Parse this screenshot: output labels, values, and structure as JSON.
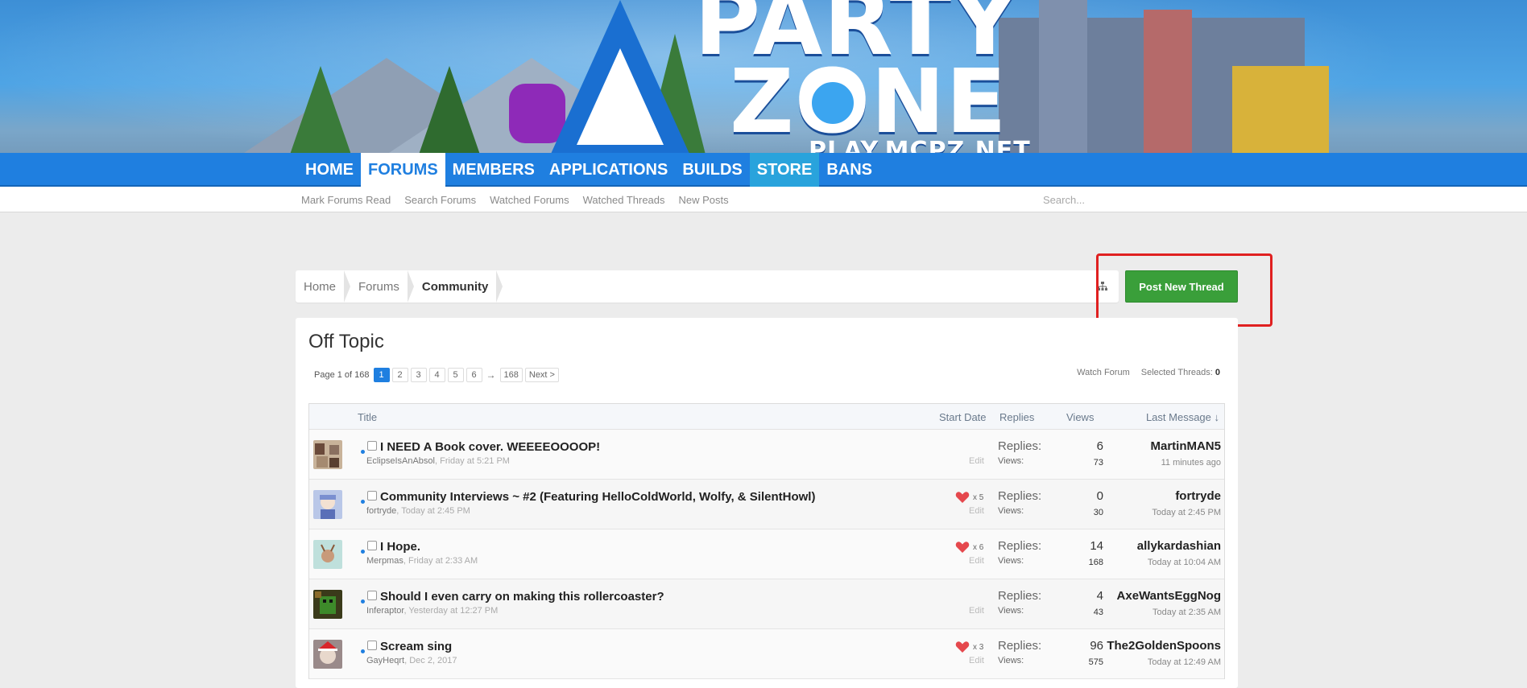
{
  "banner": {
    "logo_line1": "PARTY",
    "logo_line2": "ZONE",
    "logo_url": "PLAY.MCPZ.NET"
  },
  "nav": {
    "tabs": [
      {
        "label": "HOME"
      },
      {
        "label": "FORUMS"
      },
      {
        "label": "MEMBERS"
      },
      {
        "label": "APPLICATIONS"
      },
      {
        "label": "BUILDS"
      },
      {
        "label": "STORE"
      },
      {
        "label": "BANS"
      }
    ]
  },
  "subnav": {
    "links": [
      "Mark Forums Read",
      "Search Forums",
      "Watched Forums",
      "Watched Threads",
      "New Posts"
    ],
    "search_placeholder": "Search..."
  },
  "breadcrumb": {
    "items": [
      "Home",
      "Forums",
      "Community"
    ]
  },
  "actions": {
    "post_new_thread": "Post New Thread"
  },
  "forum": {
    "title": "Off Topic",
    "page_label": "Page 1 of 168",
    "pages": [
      "1",
      "2",
      "3",
      "4",
      "5",
      "6"
    ],
    "ellipsis": "→",
    "last_page": "168",
    "next": "Next >",
    "watch": "Watch Forum",
    "selected_label": "Selected Threads:",
    "selected_count": "0"
  },
  "table": {
    "headers": {
      "title": "Title",
      "start_date": "Start Date",
      "replies": "Replies",
      "views": "Views",
      "last_message": "Last Message ↓"
    },
    "labels": {
      "replies": "Replies:",
      "views": "Views:",
      "edit": "Edit"
    },
    "rows": [
      {
        "title": "I NEED A Book cover. WEEEEOOOOP!",
        "author": "EclipseIsAnAbsol",
        "date": "Friday at 5:21 PM",
        "likes": "",
        "replies": "6",
        "views": "73",
        "last_user": "MartinMAN5",
        "last_time": "11 minutes ago"
      },
      {
        "title": "Community Interviews ~ #2 (Featuring HelloColdWorld, Wolfy, & SilentHowl)",
        "author": "fortryde",
        "date": "Today at 2:45 PM",
        "likes": "x 5",
        "replies": "0",
        "views": "30",
        "last_user": "fortryde",
        "last_time": "Today at 2:45 PM"
      },
      {
        "title": "I Hope.",
        "author": "Merpmas",
        "date": "Friday at 2:33 AM",
        "likes": "x 6",
        "replies": "14",
        "views": "168",
        "last_user": "allykardashian",
        "last_time": "Today at 10:04 AM"
      },
      {
        "title": "Should I even carry on making this rollercoaster?",
        "author": "Inferaptor",
        "date": "Yesterday at 12:27 PM",
        "likes": "",
        "replies": "4",
        "views": "43",
        "last_user": "AxeWantsEggNog",
        "last_time": "Today at 2:35 AM"
      },
      {
        "title": "Scream sing",
        "author": "GayHeqrt",
        "date": "Dec 2, 2017",
        "likes": "x 3",
        "replies": "96",
        "views": "575",
        "last_user": "The2GoldenSpoons",
        "last_time": "Today at 12:49 AM"
      }
    ]
  },
  "colors": {
    "nav_blue": "#1f7fe0",
    "post_button_green": "#3a9f3a",
    "annotation_red": "#e02020"
  }
}
